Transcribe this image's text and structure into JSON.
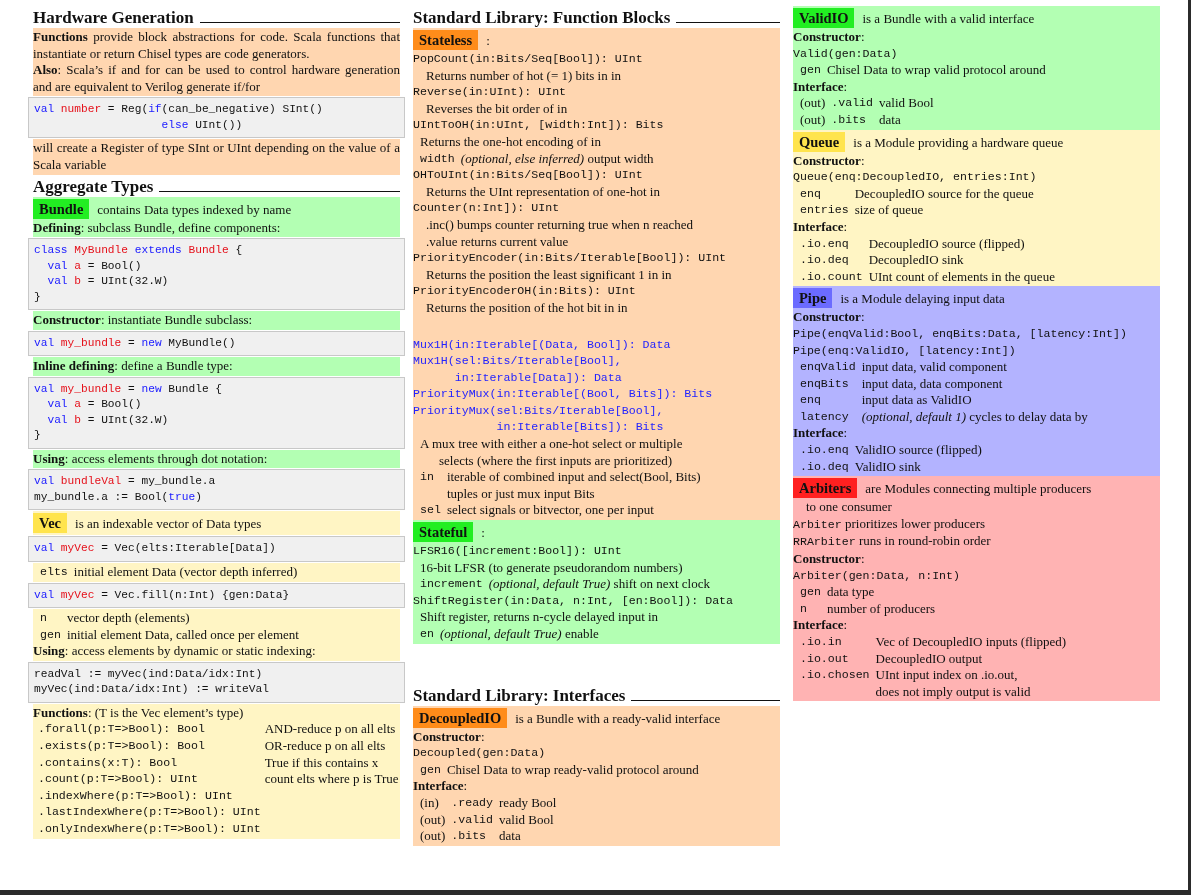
{
  "columns": [
    {
      "blocks": [
        {
          "kind": "heading",
          "text": "Hardware Generation"
        },
        {
          "kind": "panel",
          "color": "#ffd6b0",
          "lines": [
            {
              "kind": "prose",
              "text": "**Functions** provide block abstractions for code.  Scala functions that instantiate or return Chisel types are code generators."
            },
            {
              "kind": "prose",
              "text": "**Also**:  Scala’s if and for can be used to control hardware generation and are equivalent to Verilog generate if/for"
            }
          ]
        },
        {
          "kind": "code",
          "lines": [
            [
              {
                "kind": "keyword",
                "text": "val "
              },
              {
                "kind": "name",
                "text": "number"
              },
              {
                "kind": "plain",
                "text": " = Reg("
              },
              {
                "kind": "keyword",
                "text": "if"
              },
              {
                "kind": "plain",
                "text": "(can_be_negative) SInt()"
              }
            ],
            [
              {
                "kind": "keyword",
                "text": "                   else"
              },
              {
                "kind": "plain",
                "text": " UInt())"
              }
            ]
          ]
        },
        {
          "kind": "panel",
          "color": "#ffd6b0",
          "lines": [
            {
              "kind": "prose",
              "text": "will create a Register of type SInt or UInt depending on the value of a Scala variable"
            }
          ]
        },
        {
          "kind": "heading",
          "text": "Aggregate Types"
        },
        {
          "kind": "panel",
          "color": "#b3ffb3",
          "lines": [
            {
              "kind": "tagline",
              "tag": "Bundle",
              "color": "#22ee22",
              "text": "contains Data types indexed by name"
            },
            {
              "kind": "prose",
              "text": "**Defining**: subclass Bundle, define components:"
            }
          ]
        },
        {
          "kind": "code",
          "lines": [
            [
              {
                "kind": "keyword",
                "text": "class "
              },
              {
                "kind": "name",
                "text": "MyBundle "
              },
              {
                "kind": "keyword",
                "text": "extends "
              },
              {
                "kind": "name",
                "text": "Bundle"
              },
              {
                "kind": "plain",
                "text": " {"
              }
            ],
            [
              {
                "kind": "keyword",
                "text": "  val "
              },
              {
                "kind": "name",
                "text": "a"
              },
              {
                "kind": "plain",
                "text": " = Bool()"
              }
            ],
            [
              {
                "kind": "keyword",
                "text": "  val "
              },
              {
                "kind": "name",
                "text": "b"
              },
              {
                "kind": "plain",
                "text": " = UInt(32.W)"
              }
            ],
            [
              {
                "kind": "plain",
                "text": "}"
              }
            ]
          ]
        },
        {
          "kind": "panel",
          "color": "#b3ffb3",
          "lines": [
            {
              "kind": "prose",
              "text": "**Constructor**: instantiate Bundle subclass:"
            }
          ]
        },
        {
          "kind": "code",
          "lines": [
            [
              {
                "kind": "keyword",
                "text": "val "
              },
              {
                "kind": "name",
                "text": "my_bundle"
              },
              {
                "kind": "plain",
                "text": " = "
              },
              {
                "kind": "keyword",
                "text": "new"
              },
              {
                "kind": "plain",
                "text": " MyBundle()"
              }
            ]
          ]
        },
        {
          "kind": "panel",
          "color": "#b3ffb3",
          "lines": [
            {
              "kind": "prose",
              "text": "**Inline defining**: define a Bundle type:"
            }
          ]
        },
        {
          "kind": "code",
          "lines": [
            [
              {
                "kind": "keyword",
                "text": "val "
              },
              {
                "kind": "name",
                "text": "my_bundle"
              },
              {
                "kind": "plain",
                "text": " = "
              },
              {
                "kind": "keyword",
                "text": "new"
              },
              {
                "kind": "plain",
                "text": " Bundle {"
              }
            ],
            [
              {
                "kind": "keyword",
                "text": "  val "
              },
              {
                "kind": "name",
                "text": "a"
              },
              {
                "kind": "plain",
                "text": " = Bool()"
              }
            ],
            [
              {
                "kind": "keyword",
                "text": "  val "
              },
              {
                "kind": "name",
                "text": "b"
              },
              {
                "kind": "plain",
                "text": " = UInt(32.W)"
              }
            ],
            [
              {
                "kind": "plain",
                "text": "}"
              }
            ]
          ]
        },
        {
          "kind": "panel",
          "color": "#b3ffb3",
          "lines": [
            {
              "kind": "prose",
              "text": "**Using**: access elements through dot notation:"
            }
          ]
        },
        {
          "kind": "code",
          "lines": [
            [
              {
                "kind": "keyword",
                "text": "val "
              },
              {
                "kind": "name",
                "text": "bundleVal"
              },
              {
                "kind": "plain",
                "text": " = my_bundle.a"
              }
            ],
            [
              {
                "kind": "plain",
                "text": "my_bundle.a := Bool("
              },
              {
                "kind": "keyword",
                "text": "true"
              },
              {
                "kind": "plain",
                "text": ")"
              }
            ]
          ]
        },
        {
          "kind": "panel",
          "color": "#fff5c4",
          "lines": [
            {
              "kind": "tagline",
              "tag": "Vec",
              "color": "#ffe44d",
              "text": "is an indexable vector of Data types"
            }
          ]
        },
        {
          "kind": "code",
          "lines": [
            [
              {
                "kind": "keyword",
                "text": "val "
              },
              {
                "kind": "name",
                "text": "myVec"
              },
              {
                "kind": "plain",
                "text": " = Vec(elts:Iterable[Data])"
              }
            ]
          ]
        },
        {
          "kind": "panel",
          "color": "#fff5c4",
          "lines": [
            {
              "kind": "field",
              "term": "elts",
              "text": "initial element Data (vector depth inferred)"
            }
          ]
        },
        {
          "kind": "code",
          "lines": [
            [
              {
                "kind": "keyword",
                "text": "val "
              },
              {
                "kind": "name",
                "text": "myVec"
              },
              {
                "kind": "plain",
                "text": " = Vec.fill(n:Int) {gen:Data}"
              }
            ]
          ]
        },
        {
          "kind": "panel",
          "color": "#fff5c4",
          "lines": [
            {
              "kind": "field",
              "term": "n",
              "text": "vector depth (elements)"
            },
            {
              "kind": "field",
              "term": "gen",
              "text": "initial element Data, called once per element"
            },
            {
              "kind": "prose",
              "text": "**Using**: access elements by dynamic or static indexing:"
            }
          ]
        },
        {
          "kind": "code",
          "lines": [
            [
              {
                "kind": "plain",
                "text": "readVal := myVec(ind:Data/idx:Int)"
              }
            ],
            [
              {
                "kind": "plain",
                "text": "myVec(ind:Data/idx:Int) := writeVal"
              }
            ]
          ]
        },
        {
          "kind": "panel",
          "color": "#fff5c4",
          "lines": [
            {
              "kind": "prose",
              "text": "**Functions**: (T is the Vec element’s type)"
            },
            {
              "kind": "func",
              "term": ".forall(p:T=>Bool): Bool",
              "text": "AND-reduce p on all elts"
            },
            {
              "kind": "func",
              "term": ".exists(p:T=>Bool): Bool",
              "text": "OR-reduce p on all elts"
            },
            {
              "kind": "func",
              "term": ".contains(x:T): Bool",
              "text": "True if this contains x"
            },
            {
              "kind": "func",
              "term": ".count(p:T=>Bool): UInt",
              "text": "count elts where p is True"
            },
            {
              "kind": "func",
              "term": ".indexWhere(p:T=>Bool): UInt"
            },
            {
              "kind": "func",
              "term": ".lastIndexWhere(p:T=>Bool): UInt"
            },
            {
              "kind": "func",
              "term": ".onlyIndexWhere(p:T=>Bool): UInt"
            }
          ]
        }
      ]
    },
    {
      "blocks": [
        {
          "kind": "heading",
          "text": "Standard Library: Function Blocks"
        },
        {
          "kind": "panel",
          "color": "#ffd6b0",
          "lines": [
            {
              "kind": "tagline",
              "tag": "Stateless",
              "color": "#ff8c1a",
              "text": ":"
            },
            {
              "kind": "sig",
              "text": "PopCount(in:Bits/Seq[Bool]): UInt"
            },
            {
              "kind": "desc",
              "text": "Returns number of hot (= 1) bits in in"
            },
            {
              "kind": "sig",
              "text": "Reverse(in:UInt): UInt"
            },
            {
              "kind": "desc",
              "text": "Reverses the bit order of in"
            },
            {
              "kind": "sig",
              "text": "UIntToOH(in:UInt, [width:Int]): Bits"
            },
            {
              "kind": "note",
              "text": "Returns the one-hot encoding of in"
            },
            {
              "kind": "field",
              "term": "width",
              "text": "*(optional, else inferred)* output width"
            },
            {
              "kind": "sig",
              "text": "OHToUInt(in:Bits/Seq[Bool]): UInt"
            },
            {
              "kind": "desc",
              "text": "Returns the UInt representation of one-hot in"
            },
            {
              "kind": "sig",
              "text": "Counter(n:Int]): UInt"
            },
            {
              "kind": "desc",
              "text": ".inc() bumps counter returning true when n reached"
            },
            {
              "kind": "desc",
              "text": ".value returns current value"
            },
            {
              "kind": "sig",
              "text": "PriorityEncoder(in:Bits/Iterable[Bool]): UInt"
            },
            {
              "kind": "desc",
              "text": "Returns the position the least significant 1 in in"
            },
            {
              "kind": "sig",
              "text": "PriorityEncoderOH(in:Bits): UInt"
            },
            {
              "kind": "desc",
              "text": "Returns the position of the hot bit in in"
            },
            {
              "kind": "gap"
            },
            {
              "kind": "sig",
              "color": "#2323ff",
              "text": "Mux1H(in:Iterable[(Data, Bool]): Data"
            },
            {
              "kind": "sig",
              "color": "#2323ff",
              "text": "Mux1H(sel:Bits/Iterable[Bool],"
            },
            {
              "kind": "sig",
              "color": "#2323ff",
              "text": "      in:Iterable[Data]): Data"
            },
            {
              "kind": "sig",
              "color": "#2323ff",
              "text": "PriorityMux(in:Iterable[(Bool, Bits]): Bits"
            },
            {
              "kind": "sig",
              "color": "#2323ff",
              "text": "PriorityMux(sel:Bits/Iterable[Bool],"
            },
            {
              "kind": "sig",
              "color": "#2323ff",
              "text": "            in:Iterable[Bits]): Bits"
            },
            {
              "kind": "note",
              "text": "A mux tree with either a one-hot select or multiple"
            },
            {
              "kind": "cont",
              "text": "selects (where the first inputs are prioritized)"
            },
            {
              "kind": "field",
              "term": "in",
              "text": "iterable of combined input and select(Bool, Bits)"
            },
            {
              "kind": "field",
              "text": "tuples or just mux input Bits"
            },
            {
              "kind": "field",
              "term": "sel",
              "text": "select signals or bitvector, one per input"
            }
          ]
        },
        {
          "kind": "panel",
          "color": "#b3ffb3",
          "lines": [
            {
              "kind": "tagline",
              "tag": "Stateful",
              "color": "#22ee22",
              "text": ":"
            },
            {
              "kind": "sig",
              "text": "LFSR16([increment:Bool]): UInt"
            },
            {
              "kind": "note",
              "text": "16-bit LFSR (to generate pseudorandom numbers)"
            },
            {
              "kind": "field",
              "term": "increment",
              "text": "*(optional, default True)* shift on next clock"
            },
            {
              "kind": "sig",
              "text": "ShiftRegister(in:Data, n:Int, [en:Bool]): Data"
            },
            {
              "kind": "note",
              "text": "Shift register, returns n-cycle delayed input in"
            },
            {
              "kind": "field",
              "term": "en",
              "text": "*(optional, default True)* enable"
            }
          ]
        },
        {
          "kind": "gap"
        },
        {
          "kind": "heading",
          "text": "Standard Library: Interfaces"
        },
        {
          "kind": "panel",
          "color": "#ffd6b0",
          "lines": [
            {
              "kind": "tagline",
              "tag": "DecoupledIO",
              "color": "#ff8c1a",
              "text": "is a Bundle with a ready-valid interface"
            },
            {
              "kind": "prose",
              "text": "**Constructor**:"
            },
            {
              "kind": "sig",
              "text": "Decoupled(gen:Data)"
            },
            {
              "kind": "field",
              "term": "gen",
              "text": "Chisel Data to wrap ready-valid protocol around"
            },
            {
              "kind": "prose",
              "text": "**Interface**:"
            },
            {
              "kind": "iface",
              "dir": "(in)",
              "term": ".ready",
              "text": "ready Bool"
            },
            {
              "kind": "iface",
              "dir": "(out)",
              "term": ".valid",
              "text": "valid Bool"
            },
            {
              "kind": "iface",
              "dir": "(out)",
              "term": ".bits",
              "text": "data"
            }
          ]
        }
      ]
    },
    {
      "blocks": [
        {
          "kind": "panel",
          "color": "#b3ffb3",
          "lines": [
            {
              "kind": "tagline",
              "tag": "ValidIO",
              "color": "#22ee22",
              "text": "is a Bundle with a valid interface"
            },
            {
              "kind": "prose",
              "text": "**Constructor**:"
            },
            {
              "kind": "sig",
              "text": "Valid(gen:Data)"
            },
            {
              "kind": "field",
              "term": "gen",
              "text": "Chisel Data to wrap valid protocol around"
            },
            {
              "kind": "prose",
              "text": "**Interface**:"
            },
            {
              "kind": "iface",
              "dir": "(out)",
              "term": ".valid",
              "text": "valid Bool"
            },
            {
              "kind": "iface",
              "dir": "(out)",
              "term": ".bits",
              "text": "data"
            }
          ]
        },
        {
          "kind": "panel",
          "color": "#fff5c4",
          "lines": [
            {
              "kind": "tagline",
              "tag": "Queue",
              "color": "#ffe44d",
              "text": "is a Module providing a hardware queue"
            },
            {
              "kind": "prose",
              "text": "**Constructor**:"
            },
            {
              "kind": "sig",
              "text": "Queue(enq:DecoupledIO, entries:Int)"
            },
            {
              "kind": "field",
              "term": "enq",
              "text": "DecoupledIO source for the queue"
            },
            {
              "kind": "field",
              "term": "entries",
              "text": "size of queue"
            },
            {
              "kind": "prose",
              "text": "**Interface**:"
            },
            {
              "kind": "field",
              "term": ".io.enq",
              "text": "DecoupledIO source (flipped)"
            },
            {
              "kind": "field",
              "term": ".io.deq",
              "text": "DecoupledIO sink"
            },
            {
              "kind": "field",
              "term": ".io.count",
              "text": "UInt count of elements in the queue"
            }
          ]
        },
        {
          "kind": "panel",
          "color": "#b3b3ff",
          "lines": [
            {
              "kind": "tagline",
              "tag": "Pipe",
              "color": "#6b6bff",
              "text": "is a Module delaying input data"
            },
            {
              "kind": "prose",
              "text": "**Constructor**:"
            },
            {
              "kind": "sig",
              "text": "Pipe(enqValid:Bool, enqBits:Data, [latency:Int])"
            },
            {
              "kind": "sig",
              "text": "Pipe(enq:ValidIO, [latency:Int])"
            },
            {
              "kind": "field",
              "term": "enqValid",
              "text": "input data, valid component"
            },
            {
              "kind": "field",
              "term": "enqBits",
              "text": "input data, data component"
            },
            {
              "kind": "field",
              "term": "enq",
              "text": "input data as ValidIO"
            },
            {
              "kind": "field",
              "term": "latency",
              "text": "*(optional, default 1)* cycles to delay data by"
            },
            {
              "kind": "prose",
              "text": "**Interface**:"
            },
            {
              "kind": "field",
              "term": ".io.enq",
              "text": "ValidIO source (flipped)"
            },
            {
              "kind": "field",
              "term": ".io.deq",
              "text": "ValidIO sink"
            }
          ]
        },
        {
          "kind": "panel",
          "color": "#ffb3b3",
          "lines": [
            {
              "kind": "tagline",
              "tag": "Arbiters",
              "color": "#ff2020",
              "text": "are Modules connecting multiple producers"
            },
            {
              "kind": "desc",
              "text": "to one consumer"
            },
            {
              "kind": "item",
              "term": "Arbiter",
              "text": "prioritizes lower producers"
            },
            {
              "kind": "item",
              "term": "RRArbiter",
              "text": "runs in round-robin order"
            },
            {
              "kind": "prose",
              "text": "**Constructor**:"
            },
            {
              "kind": "sig",
              "text": "Arbiter(gen:Data, n:Int)"
            },
            {
              "kind": "field",
              "term": "gen",
              "text": "data type"
            },
            {
              "kind": "field",
              "term": "n",
              "text": "number of producers"
            },
            {
              "kind": "prose",
              "text": "**Interface**:"
            },
            {
              "kind": "field",
              "term": ".io.in",
              "text": "Vec of DecoupledIO inputs (flipped)"
            },
            {
              "kind": "field",
              "term": ".io.out",
              "text": "DecoupledIO output"
            },
            {
              "kind": "field",
              "term": ".io.chosen",
              "text": "UInt input index on .io.out,"
            },
            {
              "kind": "field",
              "text": "does not imply output is valid"
            }
          ]
        }
      ]
    }
  ]
}
